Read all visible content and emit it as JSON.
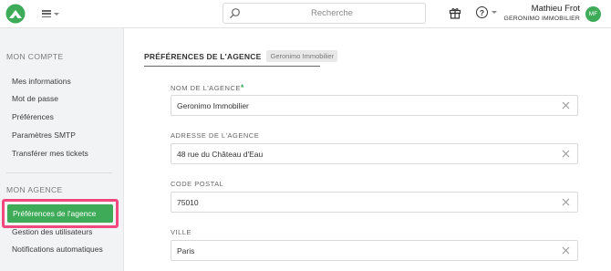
{
  "topbar": {
    "search_placeholder": "Recherche",
    "user_name": "Mathieu Frot",
    "user_org": "GERONIMO IMMOBILIER",
    "avatar_initials": "MF",
    "brand_color": "#3dab58"
  },
  "sidebar": {
    "section_account": "MON COMPTE",
    "account_items": [
      {
        "label": "Mes informations"
      },
      {
        "label": "Mot de passe"
      },
      {
        "label": "Préférences"
      },
      {
        "label": "Paramètres SMTP"
      },
      {
        "label": "Transférer mes tickets"
      }
    ],
    "section_agency": "MON AGENCE",
    "agency_items": [
      {
        "label": "Préférences de l'agence",
        "active": true
      },
      {
        "label": "Gestion des utilisateurs"
      },
      {
        "label": "Notifications automatiques"
      }
    ],
    "highlight_color": "#f2477f"
  },
  "main": {
    "tab_title": "PRÉFÉRENCES DE L'AGENCE",
    "tab_badge": "Geronimo Immobilier",
    "fields": [
      {
        "label": "NOM DE L'AGENCE",
        "required_mark": "*",
        "value": "Geronimo Immobilier"
      },
      {
        "label": "ADRESSE DE L'AGENCE",
        "value": "48 rue du Château d'Eau"
      },
      {
        "label": "CODE POSTAL",
        "value": "75010"
      },
      {
        "label": "VILLE",
        "value": "Paris"
      }
    ]
  }
}
